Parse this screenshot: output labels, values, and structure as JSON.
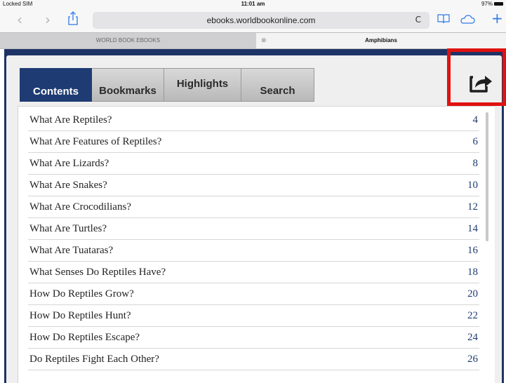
{
  "status_bar": {
    "carrier": "Locked SIM",
    "time": "11:01 am",
    "battery": "97%"
  },
  "browser": {
    "url": "ebooks.worldbookonline.com",
    "reload_glyph": "C",
    "tabs": [
      {
        "label": "WORLD BOOK EBOOKS",
        "active": false
      },
      {
        "label": "Amphibians",
        "active": true
      }
    ],
    "tab_close_glyph": "⊗",
    "icons": [
      "back-icon",
      "forward-icon",
      "share-icon",
      "bookmarks-icon",
      "cloud-icon",
      "add-tab-icon"
    ]
  },
  "reader": {
    "tabs": [
      {
        "label": "Contents",
        "active": true
      },
      {
        "label": "Bookmarks",
        "active": false
      },
      {
        "label": "Highlights",
        "active": false
      },
      {
        "label": "Search",
        "active": false
      }
    ],
    "share_icon": "export-share-icon",
    "accent_color": "#1f3b73",
    "highlight_color": "#e0120f"
  },
  "toc": {
    "items": [
      {
        "title": "What Are Reptiles?",
        "page": "4"
      },
      {
        "title": "What Are Features of Reptiles?",
        "page": "6"
      },
      {
        "title": "What Are Lizards?",
        "page": "8"
      },
      {
        "title": "What Are Snakes?",
        "page": "10"
      },
      {
        "title": "What Are Crocodilians?",
        "page": "12"
      },
      {
        "title": "What Are Turtles?",
        "page": "14"
      },
      {
        "title": "What Are Tuataras?",
        "page": "16"
      },
      {
        "title": "What Senses Do Reptiles Have?",
        "page": "18"
      },
      {
        "title": "How Do Reptiles Grow?",
        "page": "20"
      },
      {
        "title": "How Do Reptiles Hunt?",
        "page": "22"
      },
      {
        "title": "How Do Reptiles Escape?",
        "page": "24"
      },
      {
        "title": "Do Reptiles Fight Each Other?",
        "page": "26"
      }
    ]
  }
}
